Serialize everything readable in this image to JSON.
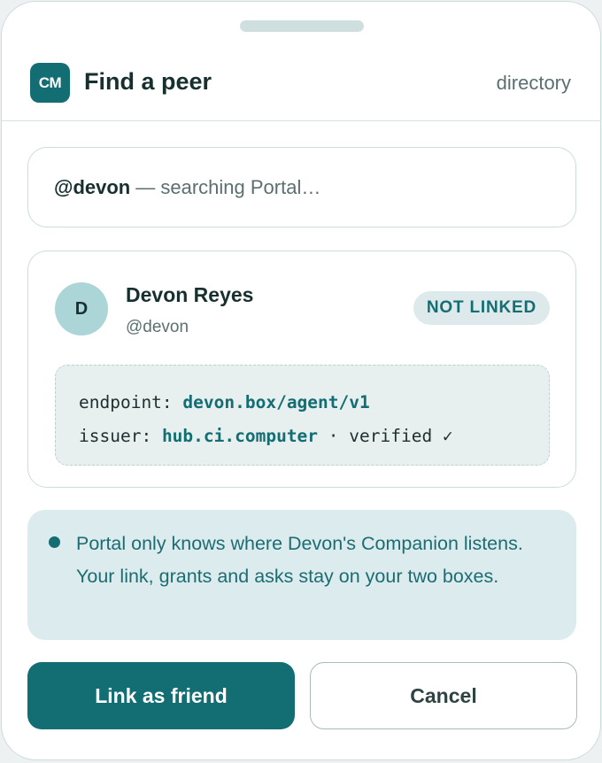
{
  "header": {
    "logo_text": "CM",
    "title": "Find a peer",
    "directory_label": "directory"
  },
  "search": {
    "handle": "@devon",
    "status": "— searching Portal…"
  },
  "peer": {
    "avatar_initial": "D",
    "name": "Devon Reyes",
    "handle": "@devon",
    "badge": "NOT LINKED",
    "endpoint_label": "endpoint:",
    "endpoint_value": "devon.box/agent/v1",
    "issuer_label": "issuer:",
    "issuer_value": "hub.ci.computer",
    "verified_text": "· verified ✓"
  },
  "note": {
    "text": "Portal only knows where Devon's Companion listens. Your link, grants and asks stay on your two boxes."
  },
  "actions": {
    "link_label": "Link as friend",
    "cancel_label": "Cancel"
  },
  "colors": {
    "accent": "#136e74",
    "note_bg": "#dcebed",
    "avatar_bg": "#acd5d7",
    "badge_bg": "#dde9ea"
  }
}
